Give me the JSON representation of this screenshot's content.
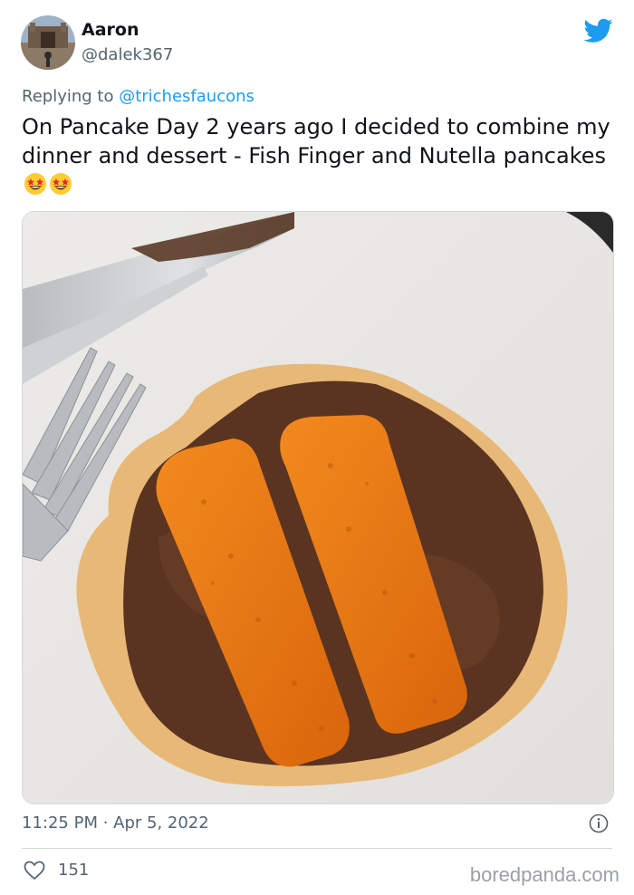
{
  "author": {
    "name": "Aaron",
    "handle": "@dalek367"
  },
  "reply": {
    "prefix": "Replying to ",
    "target": "@trichesfaucons"
  },
  "tweet": {
    "text": "On Pancake Day 2 years ago I decided to combine my dinner and dessert - Fish Finger and Nutella pancakes",
    "emoji": [
      "star-struck-emoji",
      "star-struck-emoji"
    ]
  },
  "meta": {
    "time": "11:25 PM · Apr 5, 2022",
    "likes": "151"
  },
  "watermark": "boredpanda.com",
  "colors": {
    "accent": "#1d9bf0",
    "secondary_text": "#536471",
    "border": "#cfd9de"
  }
}
